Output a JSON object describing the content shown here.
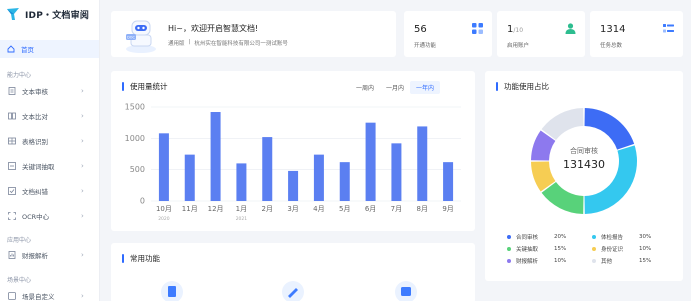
{
  "app": {
    "title": "IDP・文档审阅"
  },
  "sidebar": {
    "home_label": "首页",
    "groups": [
      {
        "title": "能力中心",
        "items": [
          "文本审核",
          "文本比对",
          "表格识别",
          "关键词抽取",
          "文档纠错",
          "OCR中心"
        ]
      },
      {
        "title": "应用中心",
        "items": [
          "财报解析"
        ]
      },
      {
        "title": "场景中心",
        "items": [
          "场景自定义"
        ]
      }
    ]
  },
  "welcome": {
    "badge": "DOC",
    "greeting": "Hi~，欢迎开启智慧文档!",
    "user": "通用版",
    "separator": "|",
    "company": "杭州实在智能科技有限公司一测试账号"
  },
  "stats": [
    {
      "value": "56",
      "suffix": "",
      "label": "开通功能",
      "color": "#3d7bff"
    },
    {
      "value": "1",
      "suffix": "/10",
      "label": "启用账户",
      "color": "#2dbd8f"
    },
    {
      "value": "1314",
      "suffix": "",
      "label": "任务总数",
      "color": "#3d7bff"
    }
  ],
  "usage": {
    "title": "使用量统计",
    "ranges": [
      "一周内",
      "一月内",
      "一年内"
    ],
    "active_range": "一年内"
  },
  "chart_data": {
    "type": "bar",
    "categories": [
      "10月",
      "11月",
      "12月",
      "1月",
      "2月",
      "3月",
      "4月",
      "5月",
      "6月",
      "7月",
      "8月",
      "9月"
    ],
    "year_labels": [
      {
        "text": "2020",
        "at": "10月"
      },
      {
        "text": "2021",
        "at": "1月"
      }
    ],
    "values": [
      1080,
      740,
      1420,
      600,
      1020,
      480,
      740,
      620,
      1250,
      920,
      1190,
      620
    ],
    "yticks": [
      0,
      500,
      1000,
      1500
    ],
    "ylim": [
      0,
      1500
    ],
    "grid": true,
    "color": "#5b7ff1"
  },
  "share": {
    "title": "功能使用占比",
    "center_label": "合同审核",
    "center_value": "131430",
    "chart_data": {
      "type": "pie",
      "slices": [
        {
          "name": "合同审核",
          "value": 20,
          "pct": "20%",
          "color": "#3d6cf5"
        },
        {
          "name": "体检报告",
          "value": 30,
          "pct": "30%",
          "color": "#34c8ef"
        },
        {
          "name": "关键抽取",
          "value": 15,
          "pct": "15%",
          "color": "#58d27a"
        },
        {
          "name": "身份证识",
          "value": 10,
          "pct": "10%",
          "color": "#f6cd53"
        },
        {
          "name": "财报解析",
          "value": 10,
          "pct": "10%",
          "color": "#8d79ee"
        },
        {
          "name": "其他",
          "value": 15,
          "pct": "15%",
          "color": "#dfe3ec"
        }
      ]
    }
  },
  "common": {
    "title": "常用功能"
  }
}
